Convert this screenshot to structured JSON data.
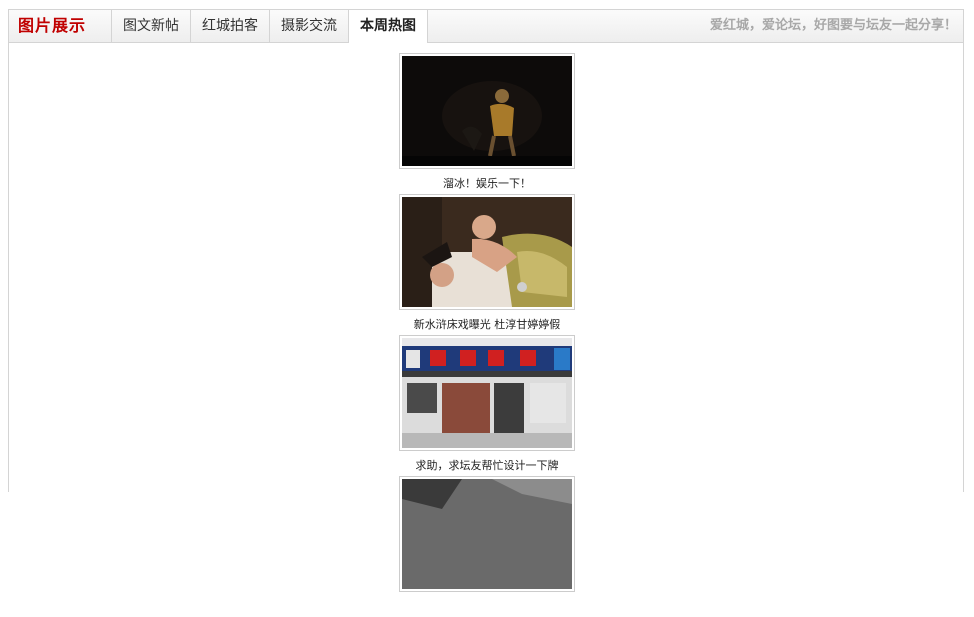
{
  "header": {
    "title": "图片展示",
    "tabs": [
      {
        "label": "图文新帖",
        "active": false
      },
      {
        "label": "红城拍客",
        "active": false
      },
      {
        "label": "摄影交流",
        "active": false
      },
      {
        "label": "本周热图",
        "active": true
      }
    ],
    "slogan": "爱红城，爱论坛，好图要与坛友一起分享！"
  },
  "gallery": {
    "items": [
      {
        "caption": "溜冰！娱乐一下！"
      },
      {
        "caption": "新水浒床戏曝光 杜淳甘婷婷假"
      },
      {
        "caption": "求助，求坛友帮忙设计一下牌"
      },
      {
        "caption": ""
      }
    ]
  },
  "colors": {
    "title": "#c00000",
    "slogan": "#a8a8a8",
    "border": "#d4d4d4"
  }
}
